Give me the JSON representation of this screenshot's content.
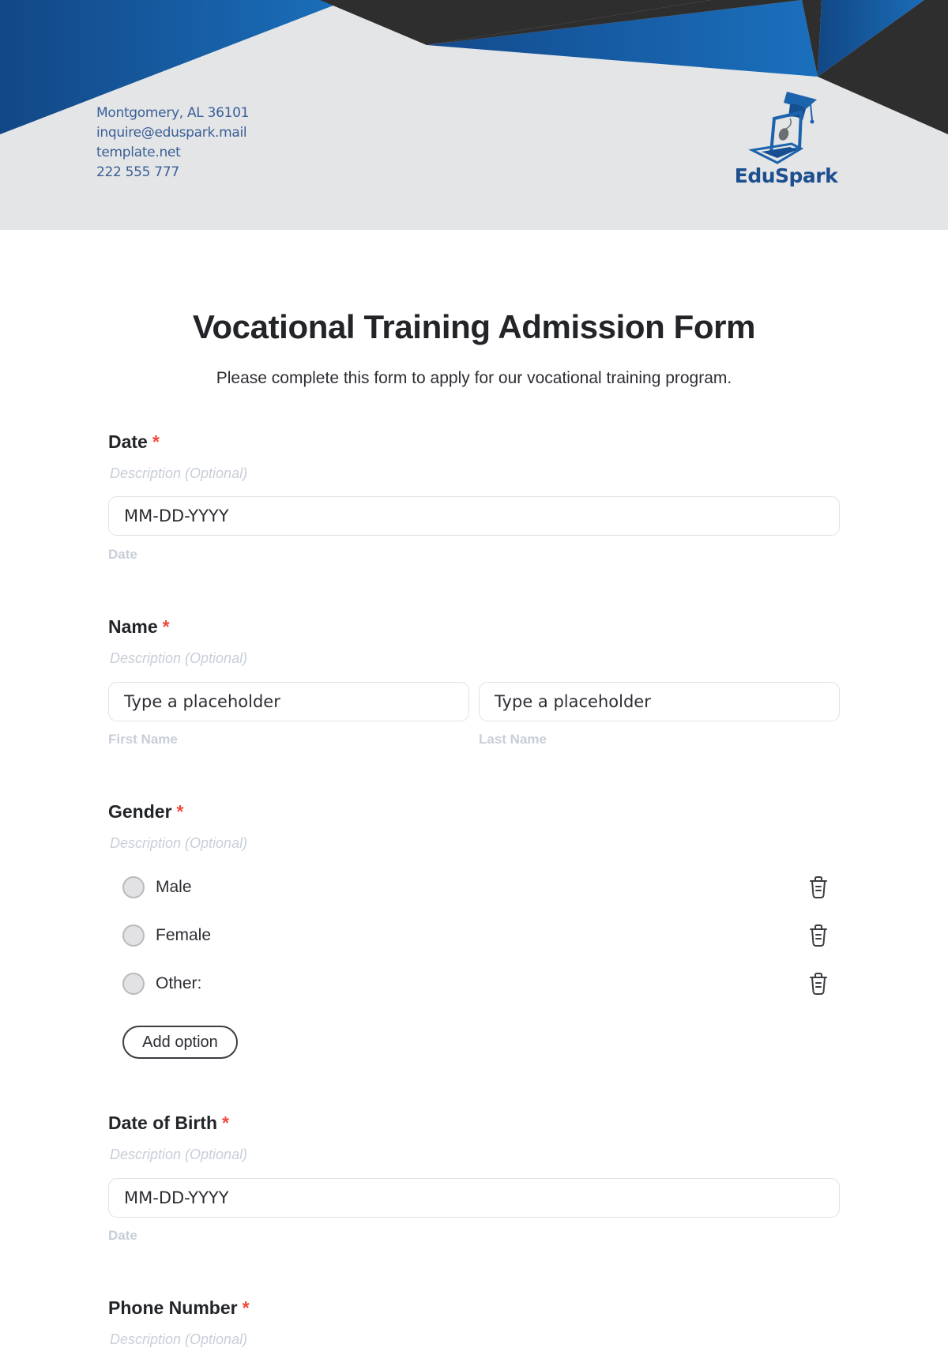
{
  "header": {
    "contact": {
      "address": "Montgomery, AL 36101",
      "email": "inquire@eduspark.mail",
      "website": "template.net",
      "phone": "222 555 777"
    },
    "logo": {
      "brand": "EduSpark",
      "icon": "laptop-graduation-cap-icon"
    },
    "colors": {
      "blue_dark": "#124a8a",
      "blue_light": "#1a6fbb",
      "charcoal": "#2e2e2e",
      "band": "#e4e5e7"
    }
  },
  "form": {
    "title": "Vocational Training Admission Form",
    "subtitle": "Please complete this form to apply for our vocational training program.",
    "required_marker": "*",
    "fields": {
      "date": {
        "label": "Date",
        "description": "Description (Optional)",
        "placeholder": "MM-DD-YYYY",
        "sublabel": "Date"
      },
      "name": {
        "label": "Name",
        "description": "Description (Optional)",
        "first_placeholder": "Type a placeholder",
        "first_sublabel": "First Name",
        "last_placeholder": "Type a placeholder",
        "last_sublabel": "Last Name"
      },
      "gender": {
        "label": "Gender",
        "description": "Description (Optional)",
        "options": [
          "Male",
          "Female",
          "Other:"
        ],
        "add_option_label": "Add option"
      },
      "dob": {
        "label": "Date of Birth",
        "description": "Description (Optional)",
        "placeholder": "MM-DD-YYYY",
        "sublabel": "Date"
      },
      "phone": {
        "label": "Phone Number",
        "description": "Description (Optional)"
      }
    },
    "colors": {
      "required": "#ef4a3a",
      "muted": "#c8ced8",
      "border": "#dfe2e8"
    }
  }
}
